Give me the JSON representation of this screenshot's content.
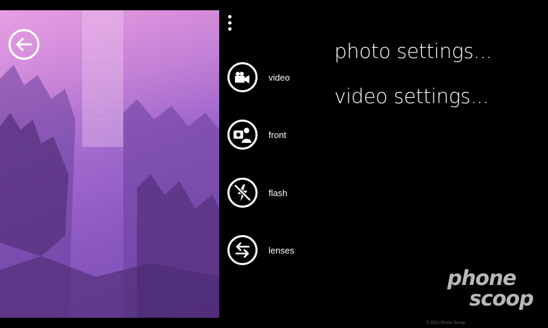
{
  "viewfinder": {
    "scene": "camera-preview",
    "tint_colors": [
      "#e6a2e6",
      "#9f67cc",
      "#7a4eb4"
    ]
  },
  "toolbar": {
    "back_icon": "back-arrow-icon",
    "more_icon": "ellipsis-icon"
  },
  "menu": {
    "items": [
      {
        "label": "video",
        "icon": "video-camera-icon"
      },
      {
        "label": "front",
        "icon": "front-camera-icon"
      },
      {
        "label": "flash",
        "icon": "flash-off-icon"
      },
      {
        "label": "lenses",
        "icon": "lenses-icon"
      }
    ]
  },
  "settings": {
    "photo_label": "photo settings...",
    "video_label": "video settings..."
  },
  "watermark": {
    "line1": "phone",
    "line2": "scoop",
    "copyright": "© 2013 Phone Scoop"
  },
  "colors": {
    "background": "#000000",
    "foreground": "#ffffff"
  }
}
